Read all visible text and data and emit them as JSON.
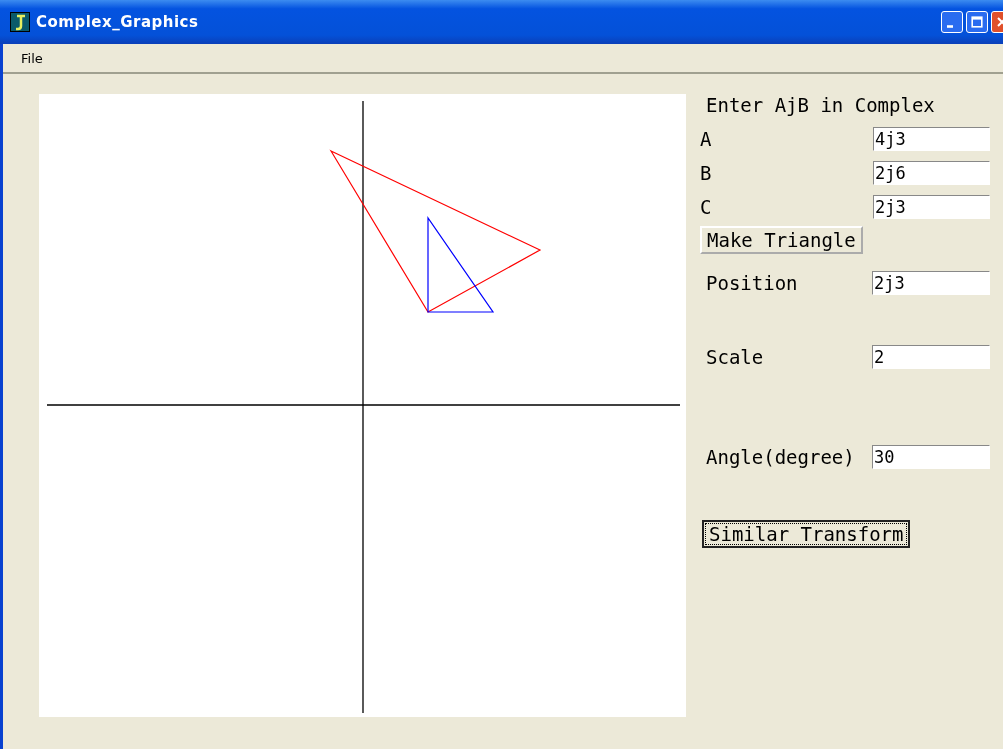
{
  "window": {
    "title": "Complex_Graphics"
  },
  "menu": [
    "File"
  ],
  "panel": {
    "heading": "Enter AjB in Complex",
    "points": [
      {
        "label": "A",
        "value": "4j3"
      },
      {
        "label": "B",
        "value": "2j6"
      },
      {
        "label": "C",
        "value": "2j3"
      }
    ],
    "make_button": "Make Triangle",
    "transform": [
      {
        "label": "Position",
        "value": "2j3"
      },
      {
        "label": "Scale",
        "value": "2"
      },
      {
        "label": "Angle(degree)",
        "value": "30"
      }
    ],
    "transform_button": "Similar Transform"
  }
}
